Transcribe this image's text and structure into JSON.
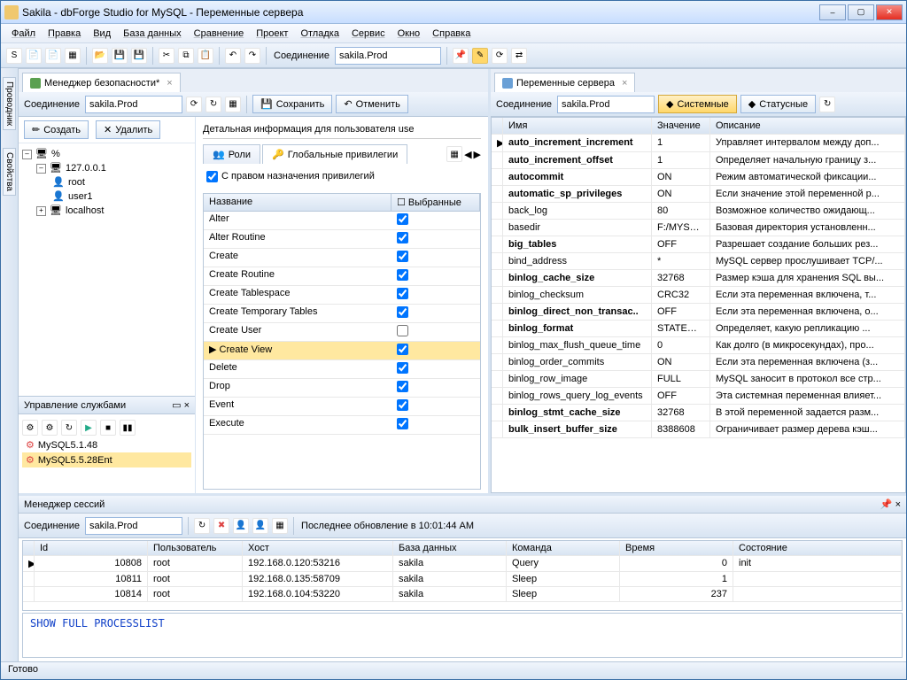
{
  "window_title": "Sakila - dbForge Studio for MySQL - Переменные сервера",
  "menu": [
    "Файл",
    "Правка",
    "Вид",
    "База данных",
    "Сравнение",
    "Проект",
    "Отладка",
    "Сервис",
    "Окно",
    "Справка"
  ],
  "toolbar": {
    "connection_label": "Соединение",
    "connection_value": "sakila.Prod"
  },
  "side_tabs": [
    "Проводник",
    "Свойства"
  ],
  "left_tab": {
    "label": "Менеджер безопасности*"
  },
  "right_tab": {
    "label": "Переменные сервера"
  },
  "left": {
    "connection_label": "Соединение",
    "connection_value": "sakila.Prod",
    "save": "Сохранить",
    "cancel": "Отменить",
    "create": "Создать",
    "delete": "Удалить",
    "tree": {
      "root": "%",
      "host": "127.0.0.1",
      "users": [
        "root",
        "user1"
      ],
      "localhost": "localhost"
    },
    "detail_header": "Детальная информация для пользователя use",
    "tabs": {
      "roles": "Роли",
      "global": "Глобальные привилегии"
    },
    "grant_checkbox": "С правом назначения привилегий",
    "priv_cols": {
      "name": "Название",
      "selected": "Выбранные"
    },
    "privs": [
      {
        "name": "Alter",
        "sel": true
      },
      {
        "name": "Alter Routine",
        "sel": true
      },
      {
        "name": "Create",
        "sel": true
      },
      {
        "name": "Create Routine",
        "sel": true
      },
      {
        "name": "Create Tablespace",
        "sel": true
      },
      {
        "name": "Create Temporary Tables",
        "sel": true
      },
      {
        "name": "Create User",
        "sel": false
      },
      {
        "name": "Create View",
        "sel": true,
        "active": true
      },
      {
        "name": "Delete",
        "sel": true
      },
      {
        "name": "Drop",
        "sel": true
      },
      {
        "name": "Event",
        "sel": true
      },
      {
        "name": "Execute",
        "sel": true
      }
    ],
    "services": {
      "title": "Управление службами",
      "items": [
        "MySQL5.1.48",
        "MySQL5.5.28Ent"
      ]
    }
  },
  "right": {
    "connection_label": "Соединение",
    "connection_value": "sakila.Prod",
    "system": "Системные",
    "status": "Статусные",
    "cols": {
      "name": "Имя",
      "value": "Значение",
      "desc": "Описание"
    },
    "rows": [
      {
        "n": "auto_increment_increment",
        "v": "1",
        "d": "Управляет интервалом между доп...",
        "b": true,
        "sel": true
      },
      {
        "n": "auto_increment_offset",
        "v": "1",
        "d": "Определяет начальную границу з...",
        "b": true
      },
      {
        "n": "autocommit",
        "v": "ON",
        "d": "Режим автоматической фиксации...",
        "b": true
      },
      {
        "n": "automatic_sp_privileges",
        "v": "ON",
        "d": "Если значение этой переменной р...",
        "b": true
      },
      {
        "n": "back_log",
        "v": "80",
        "d": "Возможное количество ожидающ..."
      },
      {
        "n": "basedir",
        "v": "F:/MYSQL...",
        "d": "Базовая директория установленн..."
      },
      {
        "n": "big_tables",
        "v": "OFF",
        "d": "Разрешает создание больших рез...",
        "b": true
      },
      {
        "n": "bind_address",
        "v": "*",
        "d": "MySQL сервер прослушивает TCP/..."
      },
      {
        "n": "binlog_cache_size",
        "v": "32768",
        "d": "Размер кэша для хранения SQL вы...",
        "b": true
      },
      {
        "n": "binlog_checksum",
        "v": "CRC32",
        "d": "Если эта переменная включена, т..."
      },
      {
        "n": "binlog_direct_non_transac..",
        "v": "OFF",
        "d": "Если эта переменная включена, о...",
        "b": true
      },
      {
        "n": "binlog_format",
        "v": "STATEMENT",
        "d": "Определяет, какую репликацию ...",
        "b": true
      },
      {
        "n": "binlog_max_flush_queue_time",
        "v": "0",
        "d": "Как долго (в микросекундах), про..."
      },
      {
        "n": "binlog_order_commits",
        "v": "ON",
        "d": "Если эта переменная включена (з..."
      },
      {
        "n": "binlog_row_image",
        "v": "FULL",
        "d": "MySQL заносит в протокол все стр..."
      },
      {
        "n": "binlog_rows_query_log_events",
        "v": "OFF",
        "d": "Эта системная переменная влияет..."
      },
      {
        "n": "binlog_stmt_cache_size",
        "v": "32768",
        "d": "В этой переменной задается разм...",
        "b": true
      },
      {
        "n": "bulk_insert_buffer_size",
        "v": "8388608",
        "d": "Ограничивает размер дерева кэш...",
        "b": true
      }
    ]
  },
  "bottom": {
    "title": "Менеджер сессий",
    "connection_label": "Соединение",
    "connection_value": "sakila.Prod",
    "last_update": "Последнее обновление в 10:01:44 AM",
    "cols": [
      "Id",
      "Пользователь",
      "Хост",
      "База данных",
      "Команда",
      "Время",
      "Состояние"
    ],
    "rows": [
      {
        "id": "10808",
        "user": "root",
        "host": "192.168.0.120:53216",
        "db": "sakila",
        "cmd": "Query",
        "time": "0",
        "state": "init"
      },
      {
        "id": "10811",
        "user": "root",
        "host": "192.168.0.135:58709",
        "db": "sakila",
        "cmd": "Sleep",
        "time": "1",
        "state": ""
      },
      {
        "id": "10814",
        "user": "root",
        "host": "192.168.0.104:53220",
        "db": "sakila",
        "cmd": "Sleep",
        "time": "237",
        "state": ""
      }
    ],
    "sql": "SHOW FULL PROCESSLIST"
  },
  "status": "Готово"
}
